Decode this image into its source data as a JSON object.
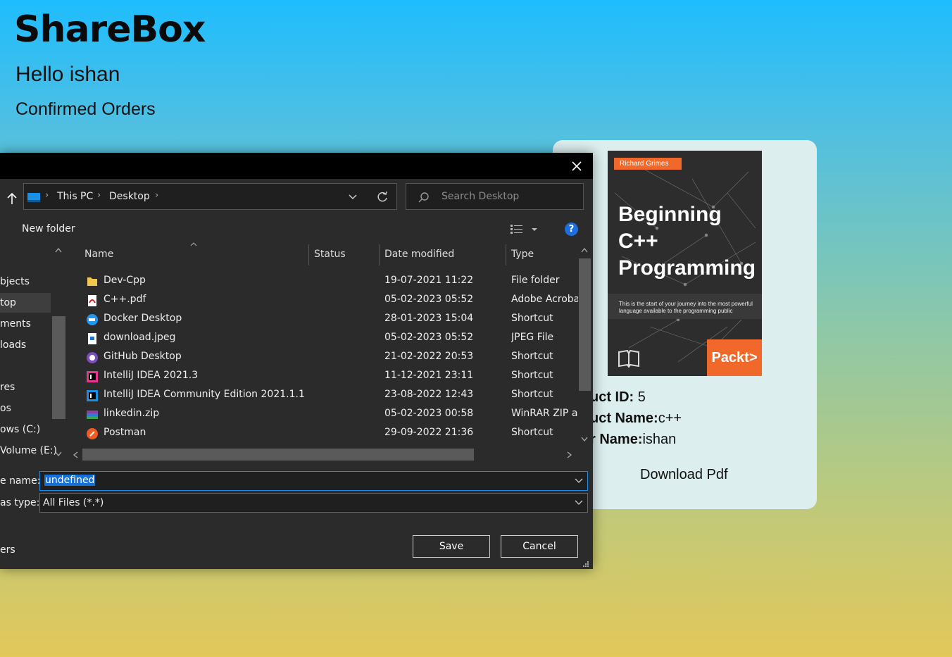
{
  "app": {
    "brand": "ShareBox",
    "greeting": "Hello ishan",
    "section_title": "Confirmed Orders"
  },
  "order_card": {
    "cover": {
      "author": "Richard Grimes",
      "title_line1": "Beginning C++",
      "title_line2": "Programming",
      "tagline": "This is the start of your journey into the most powerful language available to the programming public",
      "publisher": "Packt>"
    },
    "product_id_label": "uct ID:",
    "product_id": " 5",
    "product_name_label": "uct Name:",
    "product_name": "c++",
    "user_name_label": "r Name:",
    "user_name": "ishan",
    "download_label": "Download Pdf"
  },
  "dialog": {
    "close_icon": "close-icon",
    "breadcrumb": [
      "This PC",
      "Desktop"
    ],
    "search_placeholder": "Search Desktop",
    "new_folder_label": "New folder",
    "help_label": "?",
    "nav_items": [
      "",
      "bjects",
      "top",
      "ments",
      "loads",
      "",
      "res",
      "os",
      "ows (C:)",
      "Volume (E:)"
    ],
    "columns": {
      "name": "Name",
      "status": "Status",
      "date": "Date modified",
      "type": "Type"
    },
    "files": [
      {
        "name": "Dev-Cpp",
        "date": "19-07-2021 11:22",
        "type": "File folder",
        "icon": "folder-icon"
      },
      {
        "name": "C++.pdf",
        "date": "05-02-2023 05:52",
        "type": "Adobe Acroba",
        "icon": "pdf-icon"
      },
      {
        "name": "Docker Desktop",
        "date": "28-01-2023 15:04",
        "type": "Shortcut",
        "icon": "docker-icon"
      },
      {
        "name": "download.jpeg",
        "date": "05-02-2023 05:52",
        "type": "JPEG File",
        "icon": "image-file-icon"
      },
      {
        "name": "GitHub Desktop",
        "date": "21-02-2022 20:53",
        "type": "Shortcut",
        "icon": "github-icon"
      },
      {
        "name": "IntelliJ IDEA 2021.3",
        "date": "11-12-2021 23:11",
        "type": "Shortcut",
        "icon": "intellij-icon"
      },
      {
        "name": "IntelliJ IDEA Community Edition 2021.1.1",
        "date": "23-08-2022 12:43",
        "type": "Shortcut",
        "icon": "intellij-community-icon"
      },
      {
        "name": "linkedin.zip",
        "date": "05-02-2023 00:58",
        "type": "WinRAR ZIP ar",
        "icon": "zip-icon"
      },
      {
        "name": "Postman",
        "date": "29-09-2022 21:36",
        "type": "Shortcut",
        "icon": "postman-icon"
      }
    ],
    "file_name_label": "e name:",
    "file_name_value": "undefined",
    "save_type_label": "as type:",
    "save_type_value": "All Files (*.*)",
    "hide_folders_label": "ers",
    "save_label": "Save",
    "cancel_label": "Cancel"
  }
}
